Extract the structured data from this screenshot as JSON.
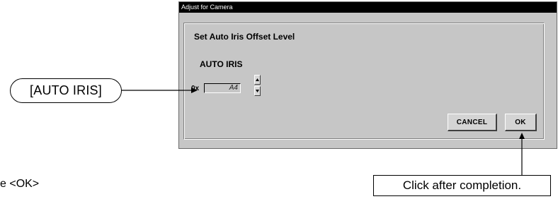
{
  "window": {
    "title": "Adjust for Camera"
  },
  "dialog": {
    "heading": "Set  Auto Iris Offset Level",
    "field_label": "AUTO IRIS",
    "prefix": "0x",
    "value": "A4",
    "buttons": {
      "cancel": "CANCEL",
      "ok": "OK"
    }
  },
  "annotations": {
    "auto_iris_callout": "[AUTO IRIS]",
    "ok_callout": "Click after completion.",
    "left_caption": "e <OK>"
  },
  "icons": {
    "spin_up": "up-triangle-icon",
    "spin_down": "down-triangle-icon"
  }
}
